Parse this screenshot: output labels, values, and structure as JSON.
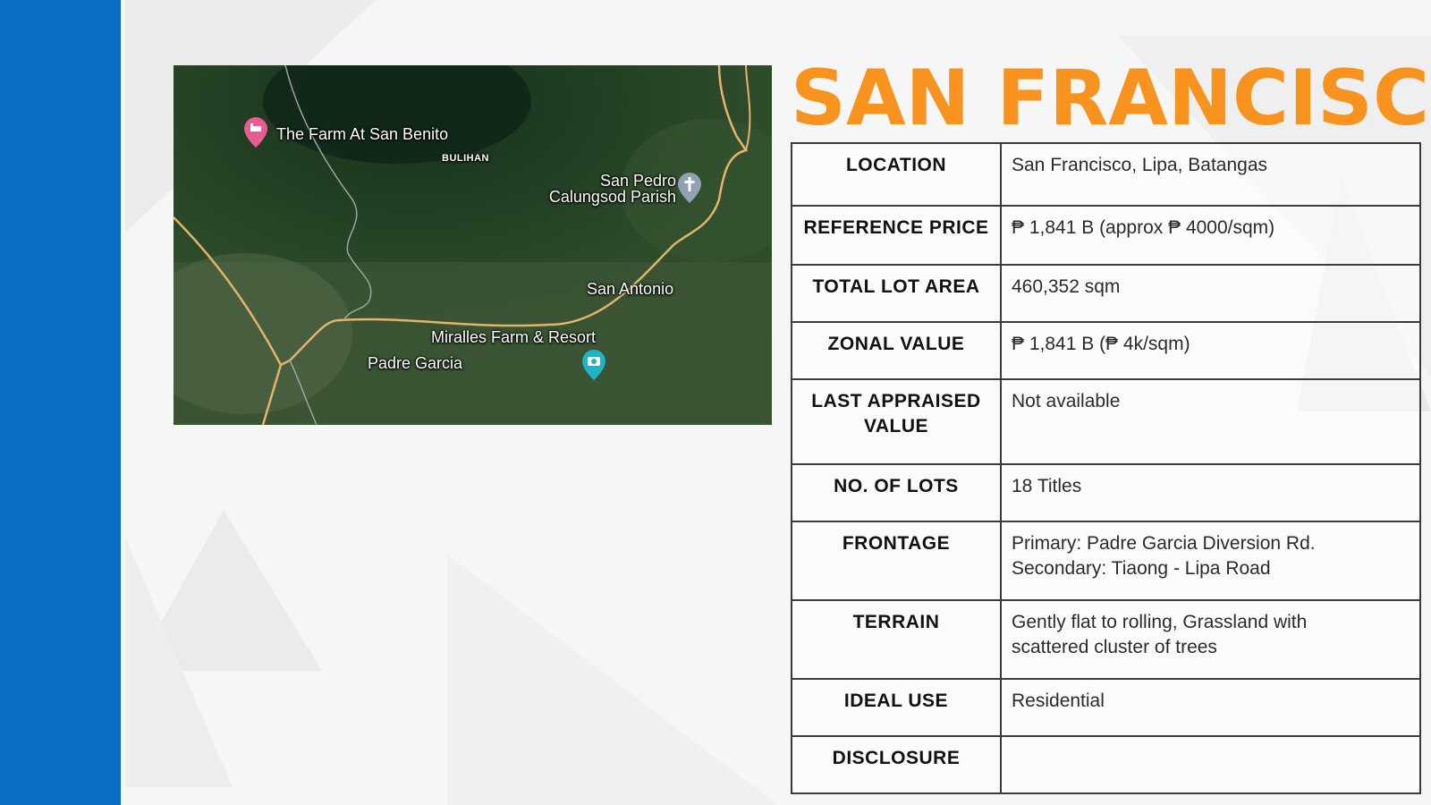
{
  "title": "SAN FRANCISCO",
  "colors": {
    "sidebar": "#0a6fc2",
    "title": "#f7931e",
    "border": "#3b3b3b"
  },
  "map": {
    "labels": [
      "The Farm At San Benito",
      "BULIHAN",
      "San Pedro",
      "Calungsod Parish",
      "San Antonio",
      "Miralles Farm & Resort",
      "Padre Garcia"
    ],
    "icons": [
      "hotel-pin-icon",
      "church-pin-icon",
      "camera-pin-icon"
    ]
  },
  "rows": [
    {
      "key": "LOCATION",
      "value": "San Francisco, Lipa, Batangas"
    },
    {
      "key": "REFERENCE PRICE",
      "value": "₱ 1,841 B (approx ₱ 4000/sqm)"
    },
    {
      "key": "TOTAL LOT AREA",
      "value": "460,352 sqm"
    },
    {
      "key": "ZONAL VALUE",
      "value": "₱ 1,841 B (₱ 4k/sqm)"
    },
    {
      "key_lines": [
        "LAST APPRAISED",
        "VALUE"
      ],
      "value": "Not available"
    },
    {
      "key": "NO. OF LOTS",
      "value": "18 Titles"
    },
    {
      "key": "FRONTAGE",
      "value_lines": [
        "Primary: Padre Garcia Diversion Rd.",
        "Secondary: Tiaong - Lipa Road"
      ]
    },
    {
      "key": "TERRAIN",
      "value_lines": [
        "Gently flat to rolling, Grassland with",
        "scattered cluster of trees"
      ]
    },
    {
      "key": "IDEAL USE",
      "value": "Residential"
    },
    {
      "key": "DISCLOSURE",
      "value": ""
    }
  ]
}
